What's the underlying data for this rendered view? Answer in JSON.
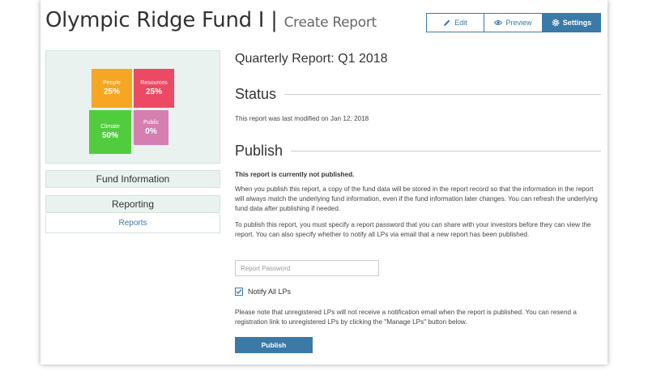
{
  "header": {
    "fund_name": "Olympic Ridge Fund I |",
    "page_name": "Create Report"
  },
  "toolbar": {
    "edit_label": "Edit",
    "preview_label": "Preview",
    "settings_label": "Settings",
    "edit_icon": "pencil-icon",
    "preview_icon": "eye-icon",
    "settings_icon": "gear-icon",
    "active": "settings"
  },
  "treemap": {
    "tiles": [
      {
        "label": "People",
        "value": "25%",
        "color": "#f5a623"
      },
      {
        "label": "Resources",
        "value": "25%",
        "color": "#ec4a64"
      },
      {
        "label": "Climate",
        "value": "50%",
        "color": "#52cc3f"
      },
      {
        "label": "Public",
        "value": "0%",
        "color": "#d57fb1"
      }
    ]
  },
  "sidebar": {
    "fund_information": "Fund Information",
    "reporting": "Reporting",
    "reports_link": "Reports"
  },
  "main": {
    "report_title": "Quarterly Report: Q1 2018",
    "status_heading": "Status",
    "status_text": "This report was last modified on Jan 12, 2018",
    "publish_heading": "Publish",
    "not_published": "This report is currently not published.",
    "publish_para1": "When you publish this report, a copy of the fund data will be stored in the report record so that the information in the report will always match the underlying fund information, even if the fund information later changes. You can refresh the underlying fund data after publishing if needed.",
    "publish_para2": "To publish this report, you must specify a report password that you can share with your investors before they can view the report. You can also specify whether to notify all LPs via email that a new report has been published.",
    "password_placeholder": "Report Password",
    "password_value": "",
    "notify_label": "Notify All LPs",
    "notify_checked": true,
    "note_text": "Please note that unregistered LPs will not receive a notification email when the report is published. You can resend a registration link to unregistered LPs by clicking the \"Manage LPs\" button below.",
    "publish_button": "Publish"
  },
  "colors": {
    "accent": "#3b7aa6",
    "panel_bg": "#e9f2ee"
  }
}
